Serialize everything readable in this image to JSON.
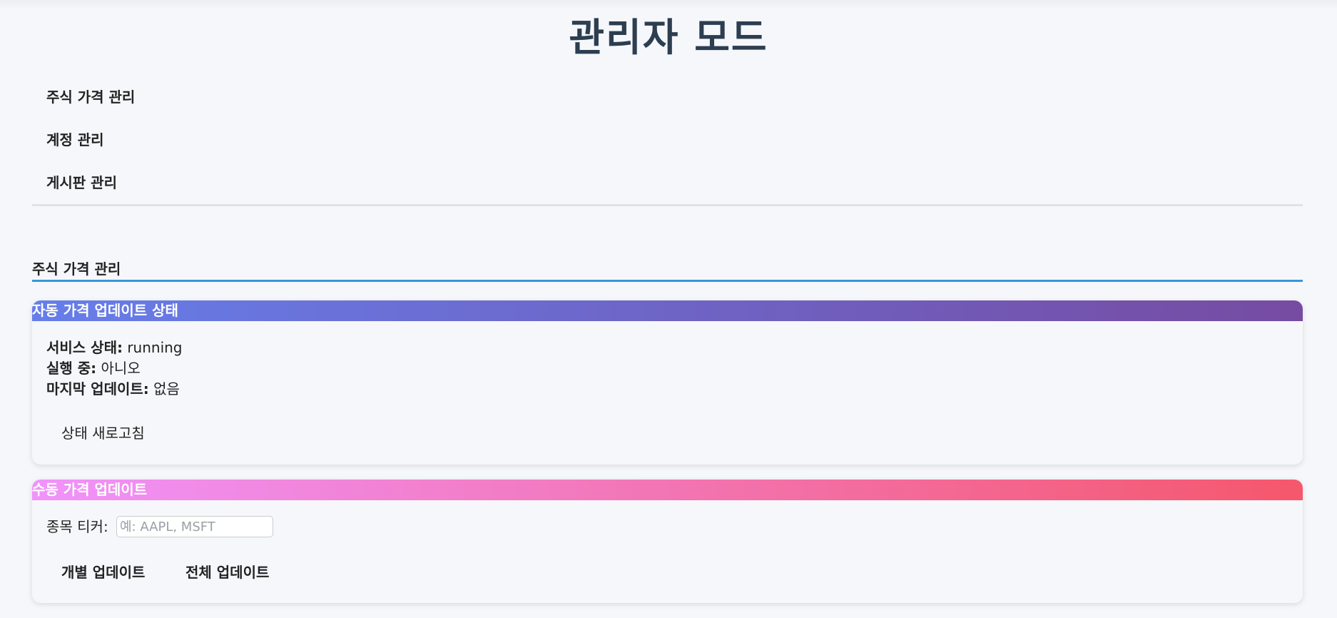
{
  "page": {
    "title": "관리자 모드"
  },
  "nav": {
    "items": [
      {
        "label": "주식 가격 관리"
      },
      {
        "label": "계정 관리"
      },
      {
        "label": "게시판 관리"
      }
    ]
  },
  "section": {
    "title": "주식 가격 관리"
  },
  "auto_update": {
    "title": "자동 가격 업데이트 상태",
    "service_status_label": "서비스 상태:",
    "service_status_value": "running",
    "running_label": "실행 중:",
    "running_value": "아니오",
    "last_update_label": "마지막 업데이트:",
    "last_update_value": "없음",
    "refresh_button": "상태 새로고침",
    "header_gradient": [
      "#667eea",
      "#764ba2"
    ]
  },
  "manual_update": {
    "title": "수동 가격 업데이트",
    "ticker_label": "종목 티커:",
    "ticker_value": "",
    "ticker_placeholder": "예: AAPL, MSFT",
    "single_update_button": "개별 업데이트",
    "all_update_button": "전체 업데이트",
    "header_gradient": [
      "#f093fb",
      "#f5576c"
    ]
  },
  "colors": {
    "title": "#2c3e50",
    "accent_line": "#3498db",
    "background": "#f5f7fa"
  }
}
